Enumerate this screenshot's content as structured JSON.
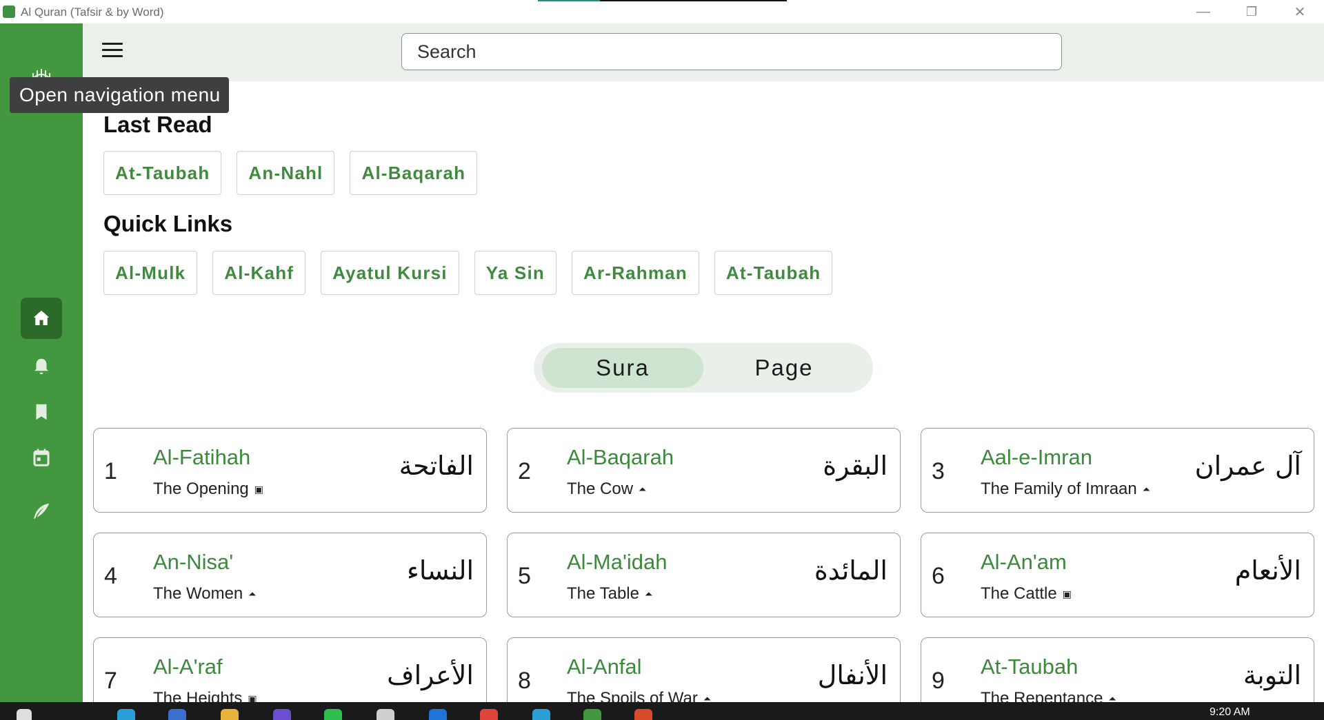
{
  "window": {
    "title": "Al Quran (Tafsir & by Word)",
    "progress": 0.25,
    "controls": {
      "minimize": "—",
      "restore": "❐",
      "close": "✕"
    }
  },
  "rail": {
    "logo_icon": "quran-logo-icon",
    "items": [
      {
        "icon": "home-icon",
        "active": true
      },
      {
        "icon": "bell-icon",
        "active": false
      },
      {
        "icon": "bookmark-icon",
        "active": false
      },
      {
        "icon": "calendar-icon",
        "active": false
      },
      {
        "icon": "quill-icon",
        "active": false
      }
    ]
  },
  "header": {
    "search_placeholder": "Search",
    "menu_tooltip": "Open navigation menu"
  },
  "last_read": {
    "title": "Last Read",
    "items": [
      "At-Taubah",
      "An-Nahl",
      "Al-Baqarah"
    ]
  },
  "quick_links": {
    "title": "Quick Links",
    "items": [
      "Al-Mulk",
      "Al-Kahf",
      "Ayatul Kursi",
      "Ya Sin",
      "Ar-Rahman",
      "At-Taubah"
    ]
  },
  "view_toggle": {
    "options": [
      "Sura",
      "Page"
    ],
    "selected": "Sura"
  },
  "suras": [
    {
      "number": "1",
      "name": "Al-Fatihah",
      "meaning": "The Opening",
      "revelation": "meccan",
      "arabic": "الفاتحة"
    },
    {
      "number": "2",
      "name": "Al-Baqarah",
      "meaning": "The Cow",
      "revelation": "medinan",
      "arabic": "البقرة"
    },
    {
      "number": "3",
      "name": "Aal-e-Imran",
      "meaning": "The Family of Imraan",
      "revelation": "medinan",
      "arabic": "آل عمران"
    },
    {
      "number": "4",
      "name": "An-Nisa'",
      "meaning": "The Women",
      "revelation": "medinan",
      "arabic": "النساء"
    },
    {
      "number": "5",
      "name": "Al-Ma'idah",
      "meaning": "The Table",
      "revelation": "medinan",
      "arabic": "المائدة"
    },
    {
      "number": "6",
      "name": "Al-An'am",
      "meaning": "The Cattle",
      "revelation": "meccan",
      "arabic": "الأنعام"
    },
    {
      "number": "7",
      "name": "Al-A'raf",
      "meaning": "The Heights",
      "revelation": "meccan",
      "arabic": "الأعراف"
    },
    {
      "number": "8",
      "name": "Al-Anfal",
      "meaning": "The Spoils of War",
      "revelation": "medinan",
      "arabic": "الأنفال"
    },
    {
      "number": "9",
      "name": "At-Taubah",
      "meaning": "The Repentance",
      "revelation": "medinan",
      "arabic": "التوبة"
    }
  ],
  "revelation_icons": {
    "meccan": "kaaba-icon",
    "medinan": "mosque-icon"
  },
  "taskbar": {
    "clock": "9:20 AM"
  },
  "colors": {
    "rail": "#43973f",
    "accent": "#3b8a3b",
    "band": "#e9f1ea"
  }
}
